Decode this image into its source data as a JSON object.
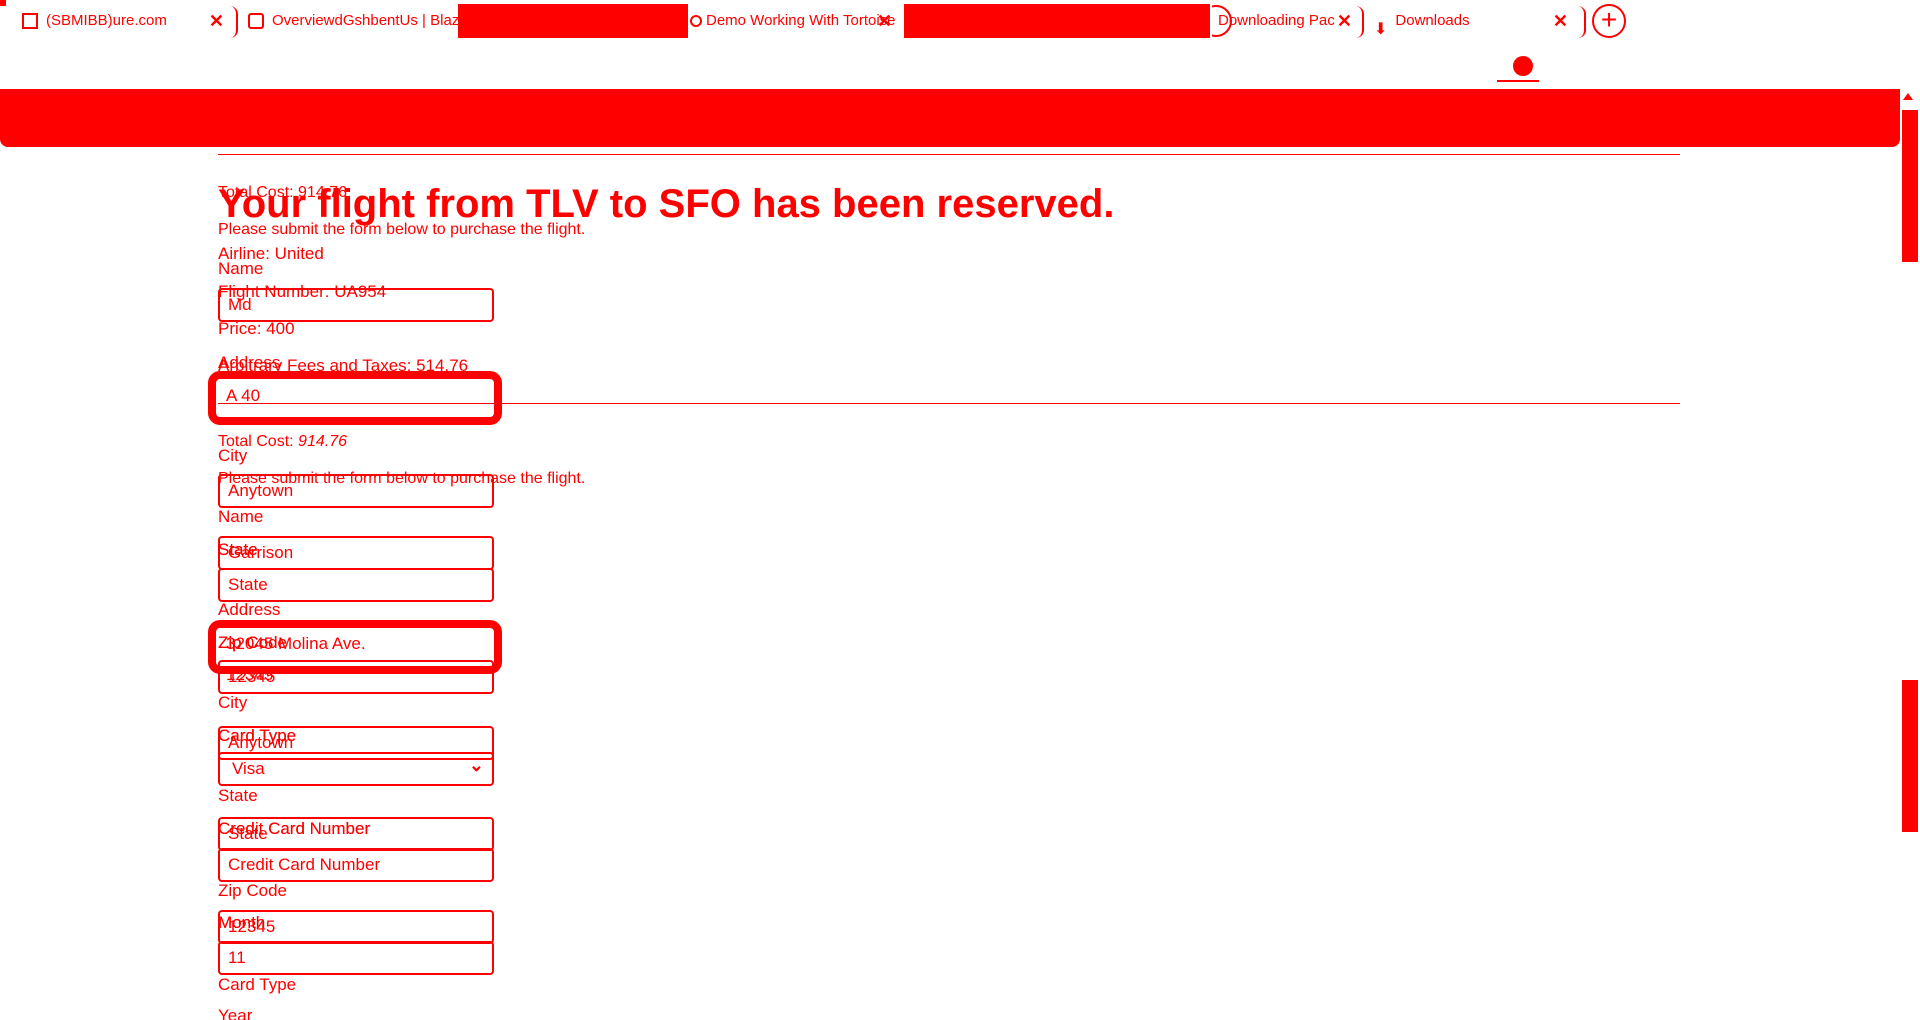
{
  "browser": {
    "tabs": [
      {
        "label": "(SBMIBB)ure.com"
      },
      {
        "label": "OverviewdGshbentUs | Blaz"
      },
      {
        "label": ""
      },
      {
        "label": "Demo Working With Tortoise"
      },
      {
        "label": ""
      },
      {
        "label": "Downloading Pac"
      },
      {
        "label": "Downloads"
      }
    ],
    "new_tab_label": "+",
    "close_glyph": "✕"
  },
  "page": {
    "ghost": {
      "total_cost": "Total Cost: 914.76",
      "submit_text": "Please submit the form below to purchase the flight.",
      "name_label": "Name",
      "name_value": "Md",
      "address_label": "Address",
      "address_value": "A 40",
      "city_label": "City",
      "city_value": "Anytown",
      "state_label": "State",
      "state_value": "Garrison",
      "zip_label": "Zip Code",
      "zip_value": "12345",
      "card_type_label": "Card Type",
      "card_type_value": "Anytown",
      "credit_card_label": "Credit Card Number",
      "credit_card_value": "State",
      "month_label": "Month",
      "month_value": "12345"
    },
    "title": "Your flight from TLV to SFO has been reserved.",
    "airline": "Airline: United",
    "flight_number": "Flight Number: UA954",
    "price": "Price: 400",
    "fees": "Arbitrary Fees and Taxes: 514.76",
    "total_cost_label": "Total Cost:",
    "total_cost_value": "914.76",
    "submit_text": "Please submit the form below to purchase the flight.",
    "form": {
      "name_label": "Name",
      "state_label": "State",
      "state_value": "State",
      "address_label": "Address",
      "address_value": "32045 Molina Ave.",
      "zip_label": "Zip Code",
      "zip_value": "12345",
      "city_label": "City",
      "card_type_label": "Card Type",
      "card_type_value": "Visa",
      "state_label2": "State",
      "credit_card_label": "Credit Card Number",
      "credit_card_placeholder": "Credit Card Number",
      "zip_label2": "Zip Code",
      "month_label": "Month",
      "month_value": "11",
      "card_type_label2": "Card Type",
      "year_label": "Year"
    }
  },
  "colors": {
    "mask": "#ff0000",
    "background": "#ffffff"
  }
}
